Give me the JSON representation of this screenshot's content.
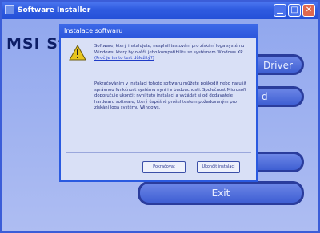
{
  "window": {
    "title": "Software Installer",
    "brand_text": "MSI Star"
  },
  "background_buttons": {
    "driver_label": "Driver",
    "button2_label": "d",
    "button3_label": "",
    "exit_label": "Exit"
  },
  "dialog": {
    "title": "Instalace softwaru",
    "paragraph1_text": "Software, který instalujete, nesplnil testování pro získání loga systému Windows, který by ověřil jeho kompatibilitu se systémem Windows XP.",
    "paragraph1_link": "(Proč je tento test důležitý?)",
    "paragraph2_text": "Pokračováním v instalaci tohoto softwaru můžete poškodit nebo narušit správnou funkčnost systému nyní i v budoucnosti. Společnost Microsoft doporučuje ukončit nyní tuto instalaci a vyžádat si od dodavatele hardwaru software, který úspěšně prošel testem požadovaným pro získání loga systému Windows.",
    "continue_label": "Pokračovat",
    "stop_label": "Ukončit instalaci"
  },
  "colors": {
    "titlebar": "#2f5be0",
    "dialog_bg": "#d9e0f6",
    "warning": "#e8c51f"
  },
  "icons": {
    "app": "installer-icon",
    "warning": "warning-icon",
    "minimize": "minimize-icon",
    "maximize": "maximize-icon",
    "close": "close-icon"
  }
}
